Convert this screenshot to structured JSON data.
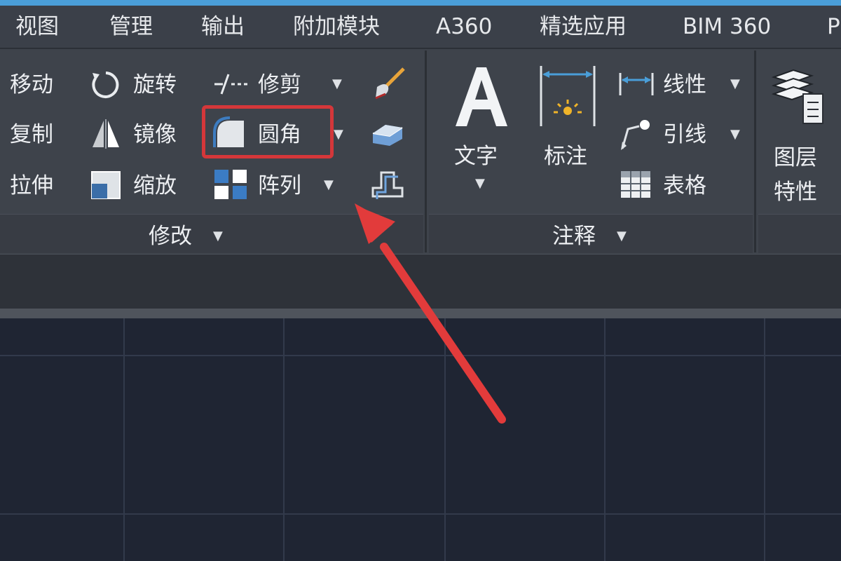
{
  "tabs": [
    {
      "label": "视图"
    },
    {
      "label": "管理"
    },
    {
      "label": "输出"
    },
    {
      "label": "附加模块"
    },
    {
      "label": "A360"
    },
    {
      "label": "精选应用"
    },
    {
      "label": "BIM 360"
    },
    {
      "label": "P"
    }
  ],
  "modify": {
    "move": "移动",
    "rotate": "旋转",
    "trim": "修剪",
    "copy": "复制",
    "mirror": "镜像",
    "fillet": "圆角",
    "stretch": "拉伸",
    "scale": "缩放",
    "array": "阵列",
    "footer": "修改"
  },
  "annotation": {
    "text": "文字",
    "dimension": "标注",
    "linear": "线性",
    "leader": "引线",
    "table": "表格",
    "footer": "注释"
  },
  "layers": {
    "properties_line1": "图层",
    "properties_line2": "特性"
  },
  "icons": {
    "rotate": "rotate-icon",
    "mirror": "mirror-icon",
    "scale": "scale-icon",
    "trim": "trim-icon",
    "fillet": "fillet-icon",
    "array": "array-icon",
    "erase": "brush-icon",
    "explode": "eraser-icon",
    "offset": "offset-icon",
    "text": "text-icon",
    "dimension": "dimension-icon",
    "linear": "linear-dimension-icon",
    "leader": "leader-icon",
    "table": "table-icon",
    "layers": "layers-icon"
  },
  "colors": {
    "highlight": "#d4373a",
    "arrow": "#e23b3b",
    "ribbon_bg": "#3e434b",
    "canvas_bg": "#1f2533",
    "accent_blue": "#4a9ed8"
  }
}
